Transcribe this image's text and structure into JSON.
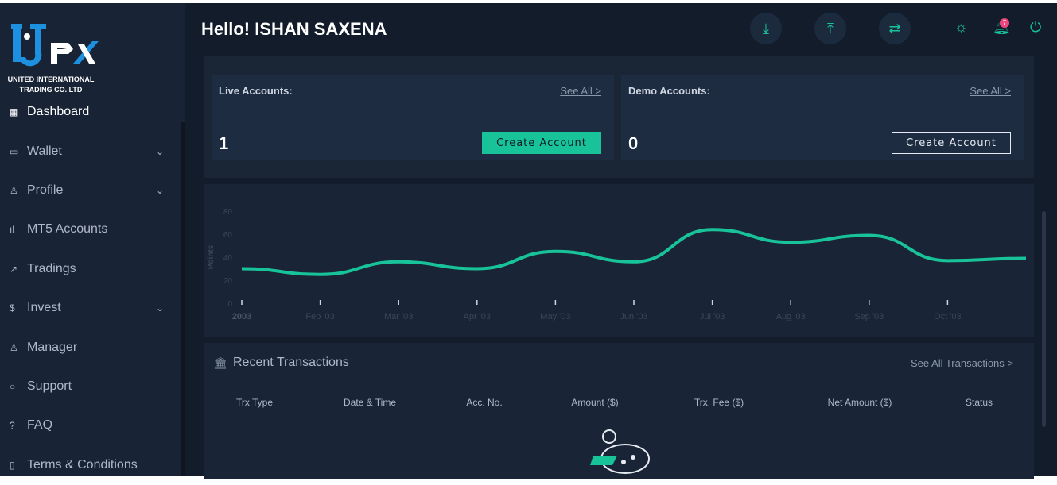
{
  "brand": {
    "logo_text": "UIFX",
    "company_line1": "UNITED INTERNATIONAL",
    "company_line2": "TRADING CO. LTD"
  },
  "sidebar": {
    "items": [
      {
        "label": "Dashboard",
        "icon": "grid-icon",
        "glyph": "▦"
      },
      {
        "label": "Wallet",
        "icon": "briefcase-icon",
        "glyph": "▭",
        "chevron": true
      },
      {
        "label": "Profile",
        "icon": "user-icon",
        "glyph": "♙",
        "chevron": true
      },
      {
        "label": "MT5 Accounts",
        "icon": "signal-icon",
        "glyph": "ıl",
        "chevron": false
      },
      {
        "label": "Tradings",
        "icon": "trend-icon",
        "glyph": "↗"
      },
      {
        "label": "Invest",
        "icon": "dollar-icon",
        "glyph": "$",
        "chevron": true
      },
      {
        "label": "Manager",
        "icon": "users-icon",
        "glyph": "♙"
      },
      {
        "label": "Support",
        "icon": "chat-icon",
        "glyph": "○"
      },
      {
        "label": "FAQ",
        "icon": "help-icon",
        "glyph": "?"
      },
      {
        "label": "Terms & Conditions",
        "icon": "document-icon",
        "glyph": "▯"
      }
    ]
  },
  "header": {
    "greeting": "Hello! ISHAN SAXENA",
    "notification_count": "7"
  },
  "accounts": {
    "live": {
      "label": "Live Accounts:",
      "see_all": "See All >",
      "count": "1",
      "button": "Create Account"
    },
    "demo": {
      "label": "Demo Accounts:",
      "see_all": "See All >",
      "count": "0",
      "button": "Create Account"
    }
  },
  "colors": {
    "accent": "#19c39a",
    "background": "#131c2b",
    "panel": "#192437"
  },
  "chart_data": {
    "type": "line",
    "x": [
      "2003",
      "Feb '03",
      "Mar '03",
      "Apr '03",
      "May '03",
      "Jun '03",
      "Jul '03",
      "Aug '03",
      "Sep '03",
      "Oct '03",
      ""
    ],
    "series": [
      {
        "name": "Points",
        "values": [
          30,
          25,
          36,
          30,
          45,
          36,
          64,
          53,
          59,
          37,
          39
        ]
      }
    ],
    "ylabel": "Points",
    "yticks": [
      0,
      20,
      40,
      60,
      80
    ],
    "ylim": [
      0,
      80
    ],
    "grid": false,
    "legend": "none"
  },
  "transactions": {
    "title": "Recent Transactions",
    "see_all": "See All Transactions >",
    "columns": [
      "Trx Type",
      "Date & Time",
      "Acc. No.",
      "Amount ($)",
      "Trx. Fee ($)",
      "Net Amount ($)",
      "Status"
    ]
  }
}
